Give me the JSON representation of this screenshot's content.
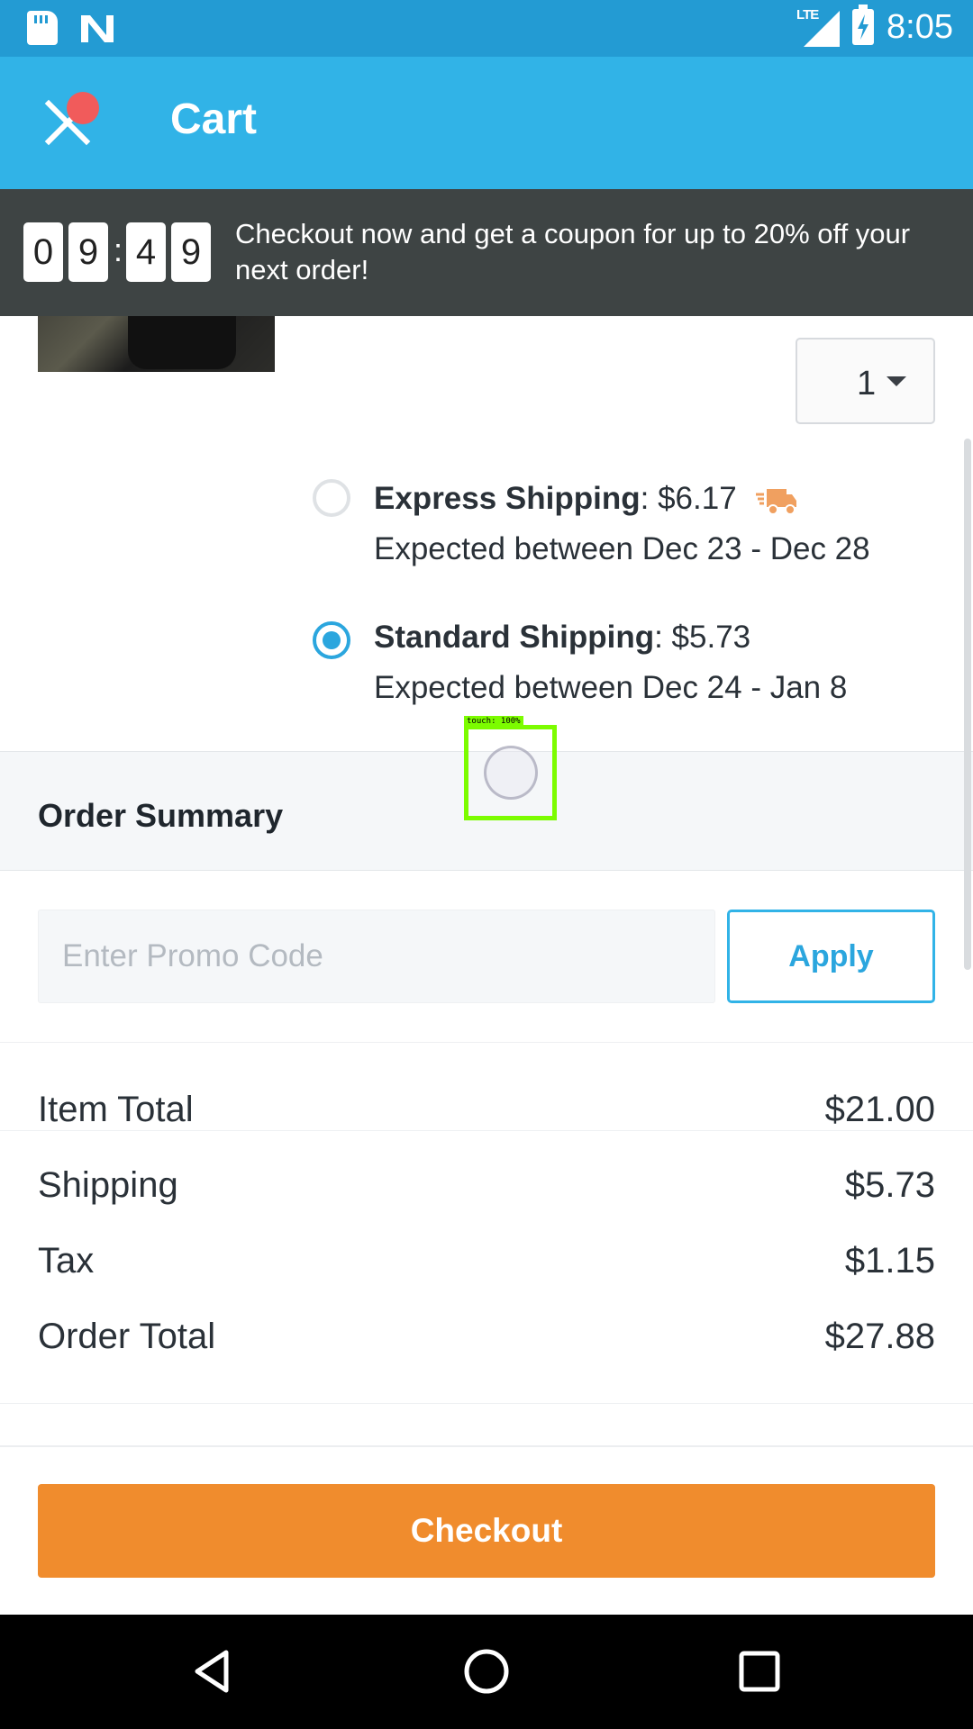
{
  "status_bar": {
    "time": "8:05",
    "network": "LTE"
  },
  "app_bar": {
    "title": "Cart"
  },
  "timer": {
    "digits": [
      "0",
      "9",
      "4",
      "9"
    ],
    "separator": ":",
    "message": "Checkout now and get a coupon for up to 20% off your next order!"
  },
  "product": {
    "quantity": "1"
  },
  "shipping": {
    "options": [
      {
        "name": "Express Shipping",
        "price": ": $6.17",
        "eta": "Expected between Dec 23 - Dec 28",
        "selected": false,
        "icon": "truck-icon"
      },
      {
        "name": "Standard Shipping",
        "price": ": $5.73",
        "eta": "Expected between Dec 24 - Jan 8",
        "selected": true
      }
    ]
  },
  "order_summary": {
    "title": "Order Summary",
    "promo_placeholder": "Enter Promo Code",
    "apply_label": "Apply",
    "rows": [
      {
        "label": "Item Total",
        "value": "$21.00"
      },
      {
        "label": "Shipping",
        "value": "$5.73"
      },
      {
        "label": "Tax",
        "value": "$1.15"
      },
      {
        "label": "Order Total",
        "value": "$27.88"
      }
    ]
  },
  "checkout_label": "Checkout",
  "touch_overlay": {
    "label": "touch: 100%"
  },
  "colors": {
    "primary": "#31b3e7",
    "status_bar": "#239bd3",
    "checkout": "#f08c2d",
    "banner": "#3e4444"
  }
}
